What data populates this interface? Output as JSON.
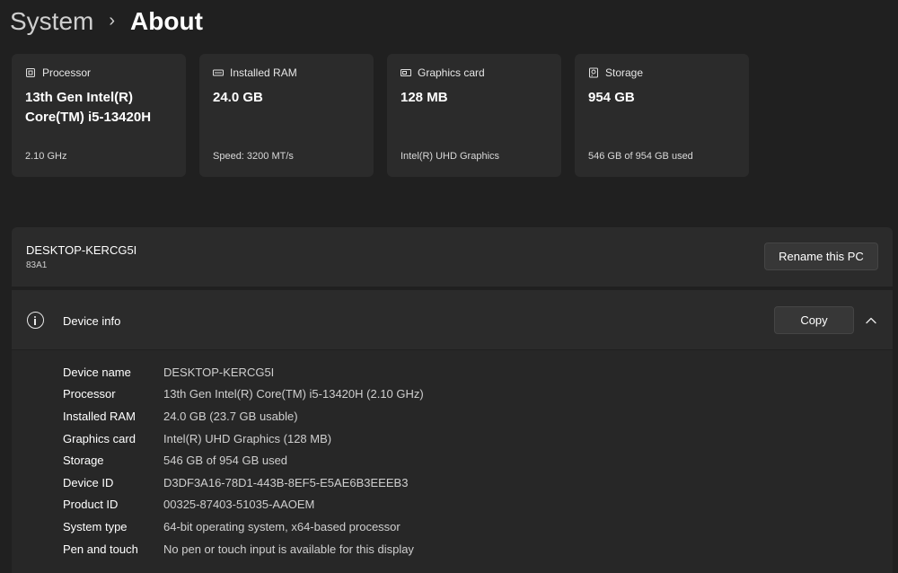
{
  "breadcrumb": {
    "parent": "System",
    "separator": "›",
    "current": "About"
  },
  "cards": [
    {
      "icon": "processor-icon",
      "label": "Processor",
      "value": "13th Gen Intel(R) Core(TM) i5-13420H",
      "sub": "2.10 GHz"
    },
    {
      "icon": "ram-icon",
      "label": "Installed RAM",
      "value": "24.0 GB",
      "sub": "Speed: 3200 MT/s"
    },
    {
      "icon": "graphics-card-icon",
      "label": "Graphics card",
      "value": "128 MB",
      "sub": "Intel(R) UHD Graphics"
    },
    {
      "icon": "storage-icon",
      "label": "Storage",
      "value": "954 GB",
      "sub": "546 GB of 954 GB used"
    }
  ],
  "pc": {
    "name": "DESKTOP-KERCG5I",
    "model": "83A1",
    "rename_label": "Rename this PC"
  },
  "device_info": {
    "title": "Device info",
    "copy_label": "Copy",
    "rows": [
      {
        "label": "Device name",
        "value": "DESKTOP-KERCG5I"
      },
      {
        "label": "Processor",
        "value": "13th Gen Intel(R) Core(TM) i5-13420H (2.10 GHz)"
      },
      {
        "label": "Installed RAM",
        "value": "24.0 GB (23.7 GB usable)"
      },
      {
        "label": "Graphics card",
        "value": "Intel(R) UHD Graphics (128 MB)"
      },
      {
        "label": "Storage",
        "value": "546 GB of 954 GB used"
      },
      {
        "label": "Device ID",
        "value": "D3DF3A16-78D1-443B-8EF5-E5AE6B3EEEB3"
      },
      {
        "label": "Product ID",
        "value": "00325-87403-51035-AAOEM"
      },
      {
        "label": "System type",
        "value": "64-bit operating system, x64-based processor"
      },
      {
        "label": "Pen and touch",
        "value": "No pen or touch input is available for this display"
      }
    ]
  },
  "colors": {
    "background": "#202020",
    "card": "#2b2b2b",
    "button": "#373737",
    "text_primary": "#ffffff",
    "text_secondary": "#cfcfcf"
  }
}
